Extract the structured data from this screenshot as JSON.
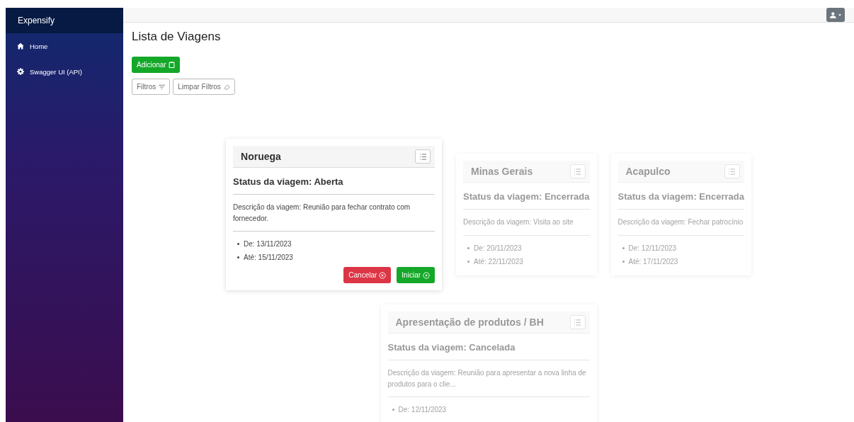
{
  "sidebar": {
    "brand": "Expensify",
    "items": [
      {
        "label": "Home",
        "kind": "home"
      },
      {
        "label": "Swagger UI (API)",
        "kind": "settings"
      }
    ]
  },
  "page_title": "Lista de Viagens",
  "add_button": "Adicionar",
  "filter_buttons": [
    {
      "label": "Filtros",
      "kind": "filter"
    },
    {
      "label": "Limpar Filtros",
      "kind": "clear"
    }
  ],
  "trips": [
    {
      "title": "Noruega",
      "active": true,
      "status": "Status da viagem: Aberta",
      "description": "Descrição da viagem: Reunião para fechar contrato com fornecedor.",
      "dates": [
        "De: 13/11/2023",
        "Até: 15/11/2023"
      ],
      "actions": [
        {
          "label": "Cancelar",
          "kind": "cancel"
        },
        {
          "label": "Iniciar",
          "kind": "start"
        }
      ]
    },
    {
      "title": "Minas Gerais",
      "active": false,
      "status": "Status da viagem: Encerrada",
      "description": "Descrição da viagem: Visita ao site",
      "dates": [
        "De: 20/11/2023",
        "Até: 22/11/2023"
      ]
    },
    {
      "title": "Acapulco",
      "active": false,
      "status": "Status da viagem: Encerrada",
      "description": "Descrição da viagem: Fechar patrocínio",
      "dates": [
        "De: 12/11/2023",
        "Até: 17/11/2023"
      ]
    },
    {
      "title": "Apresentação de produtos / BH",
      "active": false,
      "status": "Status da viagem: Cancelada",
      "description": "Descrição da viagem: Reunião para apresentar a nova linha de produtos para o clie...",
      "dates": [
        "De: 12/11/2023"
      ]
    }
  ]
}
